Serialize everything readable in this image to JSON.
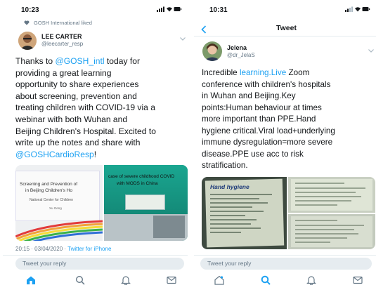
{
  "left": {
    "status_time": "10:23",
    "liked_by": "GOSH International liked",
    "author_name": "LEE CARTER",
    "author_handle": "@leecarter_resp",
    "text_parts": {
      "l1a": "Thanks to ",
      "l1b": "@GOSH_intl",
      "l1c": " today for",
      "l2": "providing a great learning",
      "l3": "opportunity to share experiences",
      "l4": "about screening, prevention and",
      "l5": "treating children with COVID-19 via a",
      "l6": "webinar with both Wuhan and",
      "l7": "Beijing Children's Hospital. Excited to",
      "l8": "write up the notes and share with",
      "l9a": "@GOSHCardioResp",
      "l9b": "!"
    },
    "slide1": {
      "line1": "Screening and Prevention of",
      "line2": "in Beijing Children's Ho",
      "line3": "National Center for Children",
      "line4": "Xu Geng"
    },
    "slide2": {
      "line1": "case of severe childhood COVID",
      "line2": "with MODS in China"
    },
    "timestamp": "20:15 · 03/04/2020 · ",
    "source": "Twitter for iPhone",
    "reply_placeholder": "Tweet your reply",
    "tabs": [
      "home-icon",
      "search-icon",
      "notifications-icon",
      "messages-icon"
    ],
    "active_tab": "home-icon"
  },
  "right": {
    "status_time": "10:31",
    "nav_title": "Tweet",
    "author_name": "Jelena",
    "author_handle": "@dr_JelaS",
    "text_parts": {
      "l1a": "Incredible ",
      "l1b": "learning.Live",
      "l1c": " Zoom",
      "l2": "conference with children's hospitals",
      "l3": "in Wuhan and Beijing.Key",
      "l4": "points:Human behaviour at times",
      "l5": "more important than PPE.Hand",
      "l6": "hygiene critical.Viral load+underlying",
      "l7": "immune dysregulation=more severe",
      "l8": "disease.PPE use acc to risk",
      "l9": "stratification."
    },
    "slide_title": "Hand hygiene",
    "reply_placeholder": "Tweet your reply",
    "tabs": [
      "home-icon",
      "search-icon",
      "notifications-icon",
      "messages-icon"
    ],
    "active_tab": "search-icon"
  },
  "colors": {
    "accent": "#1da1f2",
    "text": "#14171a",
    "secondary": "#657786",
    "reply_bg": "#e6ecf0"
  }
}
